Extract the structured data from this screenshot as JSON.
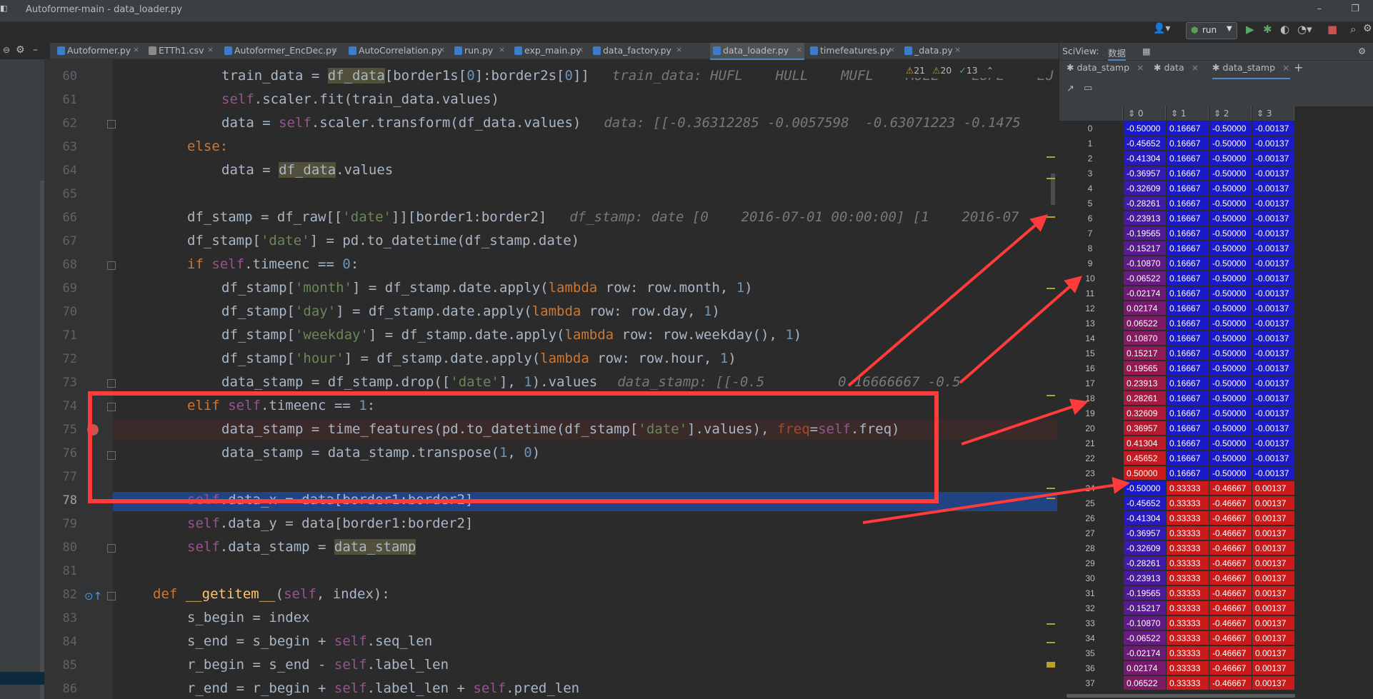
{
  "window": {
    "title": "Autoformer-main - data_loader.py",
    "minimize": "–",
    "maximize": "❐"
  },
  "toolbar": {
    "run_config": "run",
    "run_icon": "play-icon",
    "debug_icon": "bug-icon"
  },
  "tabs": [
    {
      "label": "Autoformer.py",
      "active": false
    },
    {
      "label": "ETTh1.csv",
      "active": false
    },
    {
      "label": "Autoformer_EncDec.py",
      "active": false
    },
    {
      "label": "AutoCorrelation.py",
      "active": false
    },
    {
      "label": "run.py",
      "active": false
    },
    {
      "label": "exp_main.py",
      "active": false
    },
    {
      "label": "data_factory.py",
      "active": false
    },
    {
      "label": "data_loader.py",
      "active": true
    },
    {
      "label": "timefeatures.py",
      "active": false
    },
    {
      "label": "_data.py",
      "active": false
    }
  ],
  "inspections": {
    "warnings": "21",
    "weak": "20",
    "ok": "13"
  },
  "line_numbers": [
    "60",
    "61",
    "62",
    "63",
    "64",
    "65",
    "66",
    "67",
    "68",
    "69",
    "70",
    "71",
    "72",
    "73",
    "74",
    "75",
    "76",
    "77",
    "78",
    "79",
    "80",
    "81",
    "82",
    "83",
    "84",
    "85",
    "86"
  ],
  "code": {
    "l60": "train_data = ",
    "l60b": "df_data",
    "l60c": "[border1s[",
    "l60d": "0",
    "l60e": "]:border2s[",
    "l60f": "0",
    "l60g": "]]",
    "l60hint": "train_data: HUFL    HULL    MUFL    MULL    LUFL    LU",
    "l61a": "self",
    "l61b": ".scaler.fit(train_data.values)",
    "l62a": "data = ",
    "l62b": "self",
    "l62c": ".scaler.transform(df_data.values)",
    "l62hint": "data: [[-0.36312285 -0.0057598  -0.63071223 -0.1475",
    "l63": "else:",
    "l64a": "data = ",
    "l64b": "df_data",
    "l64c": ".values",
    "l66a": "df_stamp = df_raw[[",
    "l66b": "'date'",
    "l66c": "]][border1:border2]",
    "l66hint": "df_stamp: date [0    2016-07-01 00:00:00] [1    2016-07",
    "l67a": "df_stamp[",
    "l67b": "'date'",
    "l67c": "] = pd.to_datetime(df_stamp.date)",
    "l68a": "if ",
    "l68b": "self",
    "l68c": ".timeenc == ",
    "l68d": "0",
    "l68e": ":",
    "l69a": "df_stamp[",
    "l69b": "'month'",
    "l69c": "] = df_stamp.date.apply(",
    "l69d": "lambda ",
    "l69e": "row: row.month, ",
    "l69f": "1",
    "l69g": ")",
    "l70a": "df_stamp[",
    "l70b": "'day'",
    "l70c": "] = df_stamp.date.apply(",
    "l70d": "lambda ",
    "l70e": "row: row.day, ",
    "l70f": "1",
    "l70g": ")",
    "l71a": "df_stamp[",
    "l71b": "'weekday'",
    "l71c": "] = df_stamp.date.apply(",
    "l71d": "lambda ",
    "l71e": "row: row.weekday(), ",
    "l71f": "1",
    "l71g": ")",
    "l72a": "df_stamp[",
    "l72b": "'hour'",
    "l72c": "] = df_stamp.date.apply(",
    "l72d": "lambda ",
    "l72e": "row: row.hour, ",
    "l72f": "1",
    "l72g": ")",
    "l73a": "data_stamp = df_stamp.drop([",
    "l73b": "'date'",
    "l73c": "], ",
    "l73d": "1",
    "l73e": ").values",
    "l73hint": "data_stamp: [[-0.5         0.16666667 -0.5",
    "l74a": "elif ",
    "l74b": "self",
    "l74c": ".timeenc == ",
    "l74d": "1",
    "l74e": ":",
    "l75a": "data_stamp = time_features(pd.to_datetime(df_stamp[",
    "l75b": "'date'",
    "l75c": "].values), ",
    "l75d": "freq",
    "l75e": "=",
    "l75f": "self",
    "l75g": ".freq)",
    "l76a": "data_stamp = data_stamp.transpose(",
    "l76b": "1",
    "l76c": ", ",
    "l76d": "0",
    "l76e": ")",
    "l78a": "self",
    "l78b": ".data_x = data[border1:border2]",
    "l79a": "self",
    "l79b": ".data_y = data[border1:border2]",
    "l80a": "self",
    "l80b": ".data_stamp = ",
    "l80c": "data_stamp",
    "l82a": "def ",
    "l82b": "__getitem__",
    "l82c": "(",
    "l82d": "self",
    "l82e": ", index):",
    "l83": "s_begin = index",
    "l84a": "s_end = s_begin + ",
    "l84b": "self",
    "l84c": ".seq_len",
    "l85a": "r_begin = s_end - ",
    "l85b": "self",
    "l85c": ".label_len",
    "l86a": "r_end = r_begin + ",
    "l86b": "self",
    "l86c": ".label_len + ",
    "l86d": "self",
    "l86e": ".pred_len"
  },
  "sciview": {
    "title": "SciView:",
    "data_tab": "数据",
    "tabs": [
      "data_stamp",
      "data",
      "data_stamp"
    ],
    "add": "+",
    "columns": [
      "0",
      "1",
      "2",
      "3"
    ],
    "rows": [
      [
        "0",
        "-0.50000",
        "0.16667",
        "-0.50000",
        "-0.00137"
      ],
      [
        "1",
        "-0.45652",
        "0.16667",
        "-0.50000",
        "-0.00137"
      ],
      [
        "2",
        "-0.41304",
        "0.16667",
        "-0.50000",
        "-0.00137"
      ],
      [
        "3",
        "-0.36957",
        "0.16667",
        "-0.50000",
        "-0.00137"
      ],
      [
        "4",
        "-0.32609",
        "0.16667",
        "-0.50000",
        "-0.00137"
      ],
      [
        "5",
        "-0.28261",
        "0.16667",
        "-0.50000",
        "-0.00137"
      ],
      [
        "6",
        "-0.23913",
        "0.16667",
        "-0.50000",
        "-0.00137"
      ],
      [
        "7",
        "-0.19565",
        "0.16667",
        "-0.50000",
        "-0.00137"
      ],
      [
        "8",
        "-0.15217",
        "0.16667",
        "-0.50000",
        "-0.00137"
      ],
      [
        "9",
        "-0.10870",
        "0.16667",
        "-0.50000",
        "-0.00137"
      ],
      [
        "10",
        "-0.06522",
        "0.16667",
        "-0.50000",
        "-0.00137"
      ],
      [
        "11",
        "-0.02174",
        "0.16667",
        "-0.50000",
        "-0.00137"
      ],
      [
        "12",
        "0.02174",
        "0.16667",
        "-0.50000",
        "-0.00137"
      ],
      [
        "13",
        "0.06522",
        "0.16667",
        "-0.50000",
        "-0.00137"
      ],
      [
        "14",
        "0.10870",
        "0.16667",
        "-0.50000",
        "-0.00137"
      ],
      [
        "15",
        "0.15217",
        "0.16667",
        "-0.50000",
        "-0.00137"
      ],
      [
        "16",
        "0.19565",
        "0.16667",
        "-0.50000",
        "-0.00137"
      ],
      [
        "17",
        "0.23913",
        "0.16667",
        "-0.50000",
        "-0.00137"
      ],
      [
        "18",
        "0.28261",
        "0.16667",
        "-0.50000",
        "-0.00137"
      ],
      [
        "19",
        "0.32609",
        "0.16667",
        "-0.50000",
        "-0.00137"
      ],
      [
        "20",
        "0.36957",
        "0.16667",
        "-0.50000",
        "-0.00137"
      ],
      [
        "21",
        "0.41304",
        "0.16667",
        "-0.50000",
        "-0.00137"
      ],
      [
        "22",
        "0.45652",
        "0.16667",
        "-0.50000",
        "-0.00137"
      ],
      [
        "23",
        "0.50000",
        "0.16667",
        "-0.50000",
        "-0.00137"
      ],
      [
        "24",
        "-0.50000",
        "0.33333",
        "-0.46667",
        "0.00137"
      ],
      [
        "25",
        "-0.45652",
        "0.33333",
        "-0.46667",
        "0.00137"
      ],
      [
        "26",
        "-0.41304",
        "0.33333",
        "-0.46667",
        "0.00137"
      ],
      [
        "27",
        "-0.36957",
        "0.33333",
        "-0.46667",
        "0.00137"
      ],
      [
        "28",
        "-0.32609",
        "0.33333",
        "-0.46667",
        "0.00137"
      ],
      [
        "29",
        "-0.28261",
        "0.33333",
        "-0.46667",
        "0.00137"
      ],
      [
        "30",
        "-0.23913",
        "0.33333",
        "-0.46667",
        "0.00137"
      ],
      [
        "31",
        "-0.19565",
        "0.33333",
        "-0.46667",
        "0.00137"
      ],
      [
        "32",
        "-0.15217",
        "0.33333",
        "-0.46667",
        "0.00137"
      ],
      [
        "33",
        "-0.10870",
        "0.33333",
        "-0.46667",
        "0.00137"
      ],
      [
        "34",
        "-0.06522",
        "0.33333",
        "-0.46667",
        "0.00137"
      ],
      [
        "35",
        "-0.02174",
        "0.33333",
        "-0.46667",
        "0.00137"
      ],
      [
        "36",
        "0.02174",
        "0.33333",
        "-0.46667",
        "0.00137"
      ],
      [
        "37",
        "0.06522",
        "0.33333",
        "-0.46667",
        "0.00137"
      ]
    ]
  },
  "colors": {
    "annotation": "#ff3b3b",
    "low": "#1a1acc",
    "high": "#cc1a1a"
  }
}
